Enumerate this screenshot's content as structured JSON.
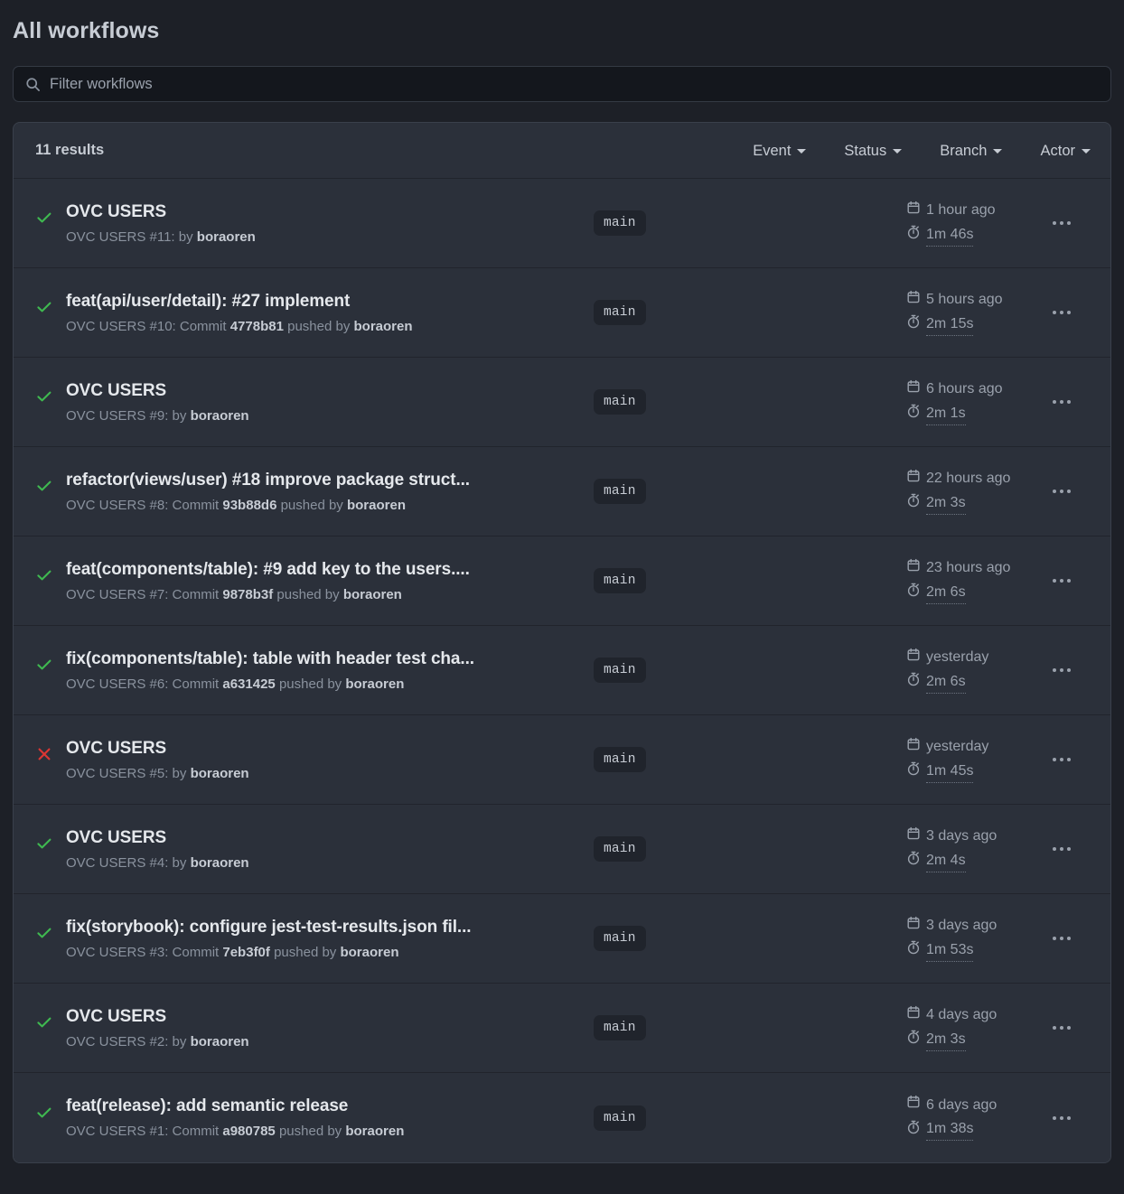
{
  "page": {
    "title": "All workflows"
  },
  "search": {
    "placeholder": "Filter workflows",
    "value": "",
    "icon": "search-icon"
  },
  "colors": {
    "page_bg": "#1d2027",
    "card_bg": "#2b303a",
    "divider": "#21242c",
    "success": "#3fb950",
    "failure": "#da3633",
    "text_primary": "#e5e8ec",
    "text_muted": "#8a929e"
  },
  "results_header": {
    "count_label": "11 results",
    "filters": [
      {
        "label": "Event",
        "icon": "chevron-down-icon"
      },
      {
        "label": "Status",
        "icon": "chevron-down-icon"
      },
      {
        "label": "Branch",
        "icon": "chevron-down-icon"
      },
      {
        "label": "Actor",
        "icon": "chevron-down-icon"
      }
    ]
  },
  "runs": [
    {
      "status": "success",
      "status_icon": "check-icon",
      "title": "OVC USERS",
      "sub_prefix": "OVC USERS #11: by ",
      "sub_actor": "boraoren",
      "branch": "main",
      "time": "1 hour ago",
      "duration": "1m 46s",
      "menu_icon": "kebab-menu-icon"
    },
    {
      "status": "success",
      "status_icon": "check-icon",
      "title": "feat(api/user/detail): #27 implement",
      "sub_prefix": "OVC USERS #10: Commit ",
      "sub_commit": "4778b81",
      "sub_middle": " pushed by ",
      "sub_actor": "boraoren",
      "branch": "main",
      "time": "5 hours ago",
      "duration": "2m 15s",
      "menu_icon": "kebab-menu-icon"
    },
    {
      "status": "success",
      "status_icon": "check-icon",
      "title": "OVC USERS",
      "sub_prefix": "OVC USERS #9: by ",
      "sub_actor": "boraoren",
      "branch": "main",
      "time": "6 hours ago",
      "duration": "2m 1s",
      "menu_icon": "kebab-menu-icon"
    },
    {
      "status": "success",
      "status_icon": "check-icon",
      "title": "refactor(views/user) #18 improve package struct...",
      "sub_prefix": "OVC USERS #8: Commit ",
      "sub_commit": "93b88d6",
      "sub_middle": " pushed by ",
      "sub_actor": "boraoren",
      "branch": "main",
      "time": "22 hours ago",
      "duration": "2m 3s",
      "menu_icon": "kebab-menu-icon"
    },
    {
      "status": "success",
      "status_icon": "check-icon",
      "title": "feat(components/table): #9 add key to the users....",
      "sub_prefix": "OVC USERS #7: Commit ",
      "sub_commit": "9878b3f",
      "sub_middle": " pushed by ",
      "sub_actor": "boraoren",
      "branch": "main",
      "time": "23 hours ago",
      "duration": "2m 6s",
      "menu_icon": "kebab-menu-icon"
    },
    {
      "status": "success",
      "status_icon": "check-icon",
      "title": "fix(components/table): table with header test cha...",
      "sub_prefix": "OVC USERS #6: Commit ",
      "sub_commit": "a631425",
      "sub_middle": " pushed by ",
      "sub_actor": "boraoren",
      "branch": "main",
      "time": "yesterday",
      "duration": "2m 6s",
      "menu_icon": "kebab-menu-icon"
    },
    {
      "status": "failure",
      "status_icon": "x-icon",
      "title": "OVC USERS",
      "sub_prefix": "OVC USERS #5: by ",
      "sub_actor": "boraoren",
      "branch": "main",
      "time": "yesterday",
      "duration": "1m 45s",
      "menu_icon": "kebab-menu-icon"
    },
    {
      "status": "success",
      "status_icon": "check-icon",
      "title": "OVC USERS",
      "sub_prefix": "OVC USERS #4: by ",
      "sub_actor": "boraoren",
      "branch": "main",
      "time": "3 days ago",
      "duration": "2m 4s",
      "menu_icon": "kebab-menu-icon"
    },
    {
      "status": "success",
      "status_icon": "check-icon",
      "title": "fix(storybook): configure jest-test-results.json fil...",
      "sub_prefix": "OVC USERS #3: Commit ",
      "sub_commit": "7eb3f0f",
      "sub_middle": " pushed by ",
      "sub_actor": "boraoren",
      "branch": "main",
      "time": "3 days ago",
      "duration": "1m 53s",
      "menu_icon": "kebab-menu-icon"
    },
    {
      "status": "success",
      "status_icon": "check-icon",
      "title": "OVC USERS",
      "sub_prefix": "OVC USERS #2: by ",
      "sub_actor": "boraoren",
      "branch": "main",
      "time": "4 days ago",
      "duration": "2m 3s",
      "menu_icon": "kebab-menu-icon"
    },
    {
      "status": "success",
      "status_icon": "check-icon",
      "title": "feat(release): add semantic release",
      "sub_prefix": "OVC USERS #1: Commit ",
      "sub_commit": "a980785",
      "sub_middle": " pushed by ",
      "sub_actor": "boraoren",
      "branch": "main",
      "time": "6 days ago",
      "duration": "1m 38s",
      "menu_icon": "kebab-menu-icon"
    }
  ]
}
